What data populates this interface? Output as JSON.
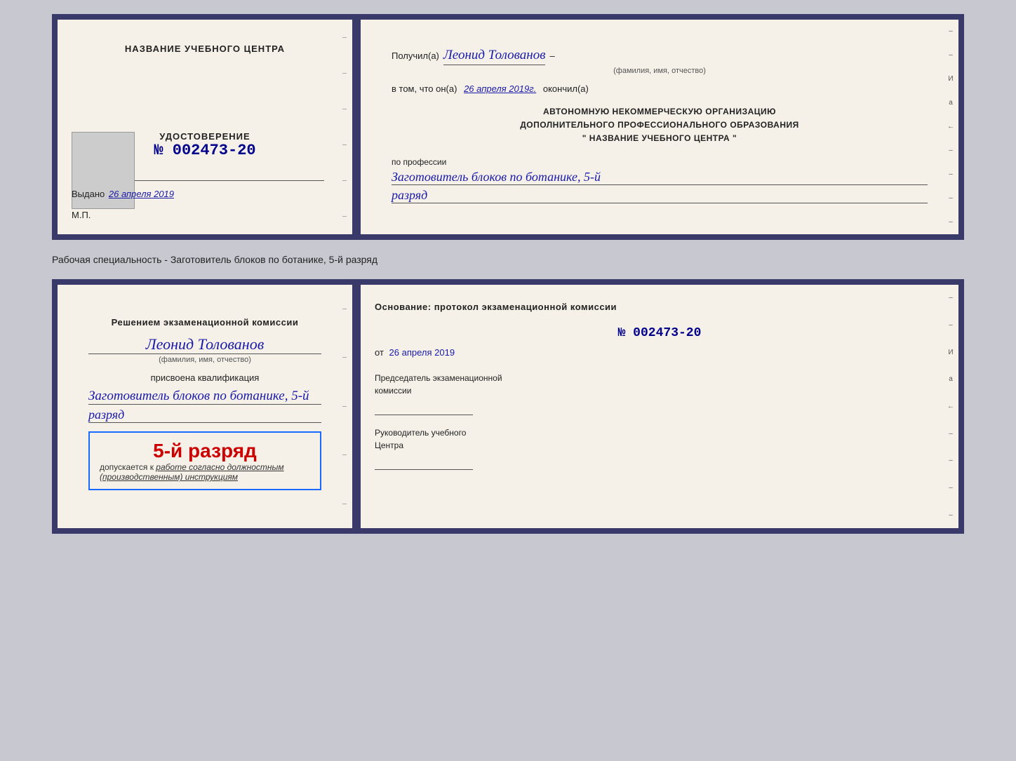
{
  "top_certificate": {
    "left": {
      "center_title": "НАЗВАНИЕ УЧЕБНОГО ЦЕНТРА",
      "udostoverenie_label": "УДОСТОВЕРЕНИЕ",
      "number": "№ 002473-20",
      "vydano_label": "Выдано",
      "vydano_date": "26 апреля 2019",
      "mp_label": "М.П."
    },
    "right": {
      "poluchil_prefix": "Получил(а)",
      "recipient_name": "Леонид Толованов",
      "fio_sublabel": "(фамилия, имя, отчество)",
      "vtom_prefix": "в том, что он(а)",
      "vtom_date": "26 апреля 2019г.",
      "okonchil": "окончил(а)",
      "org_line1": "АВТОНОМНУЮ НЕКОММЕРЧЕСКУЮ ОРГАНИЗАЦИЮ",
      "org_line2": "ДОПОЛНИТЕЛЬНОГО ПРОФЕССИОНАЛЬНОГО ОБРАЗОВАНИЯ",
      "org_line3": "\"  НАЗВАНИЕ УЧЕБНОГО ЦЕНТРА  \"",
      "po_professii_label": "по профессии",
      "profession": "Заготовитель блоков по ботанике, 5-й",
      "razryad": "разряд"
    }
  },
  "subtitle": "Рабочая специальность - Заготовитель блоков по ботанике, 5-й разряд",
  "bottom_certificate": {
    "left": {
      "resheniyem_line1": "Решением экзаменационной комиссии",
      "recipient_name": "Леонид Толованов",
      "fio_sublabel": "(фамилия, имя, отчество)",
      "prisvoena_label": "присвоена квалификация",
      "kval_text": "Заготовитель блоков по ботанике, 5-й",
      "razryad_text": "разряд",
      "stamp_rank": "5-й разряд",
      "dopuskaetsya_prefix": "допускается к",
      "dopuskaetsya_italic": "работе согласно должностным (производственным) инструкциям"
    },
    "right": {
      "osnovanie_label": "Основание: протокол экзаменационной комиссии",
      "protocol_number": "№  002473-20",
      "ot_label": "от",
      "ot_date": "26 апреля 2019",
      "predsedatel_line1": "Председатель экзаменационной",
      "predsedatel_line2": "комиссии",
      "rukovoditel_line1": "Руководитель учебного",
      "rukovoditel_line2": "Центра"
    }
  },
  "marks": {
    "И": "И",
    "а": "а",
    "arrow_left": "←"
  }
}
